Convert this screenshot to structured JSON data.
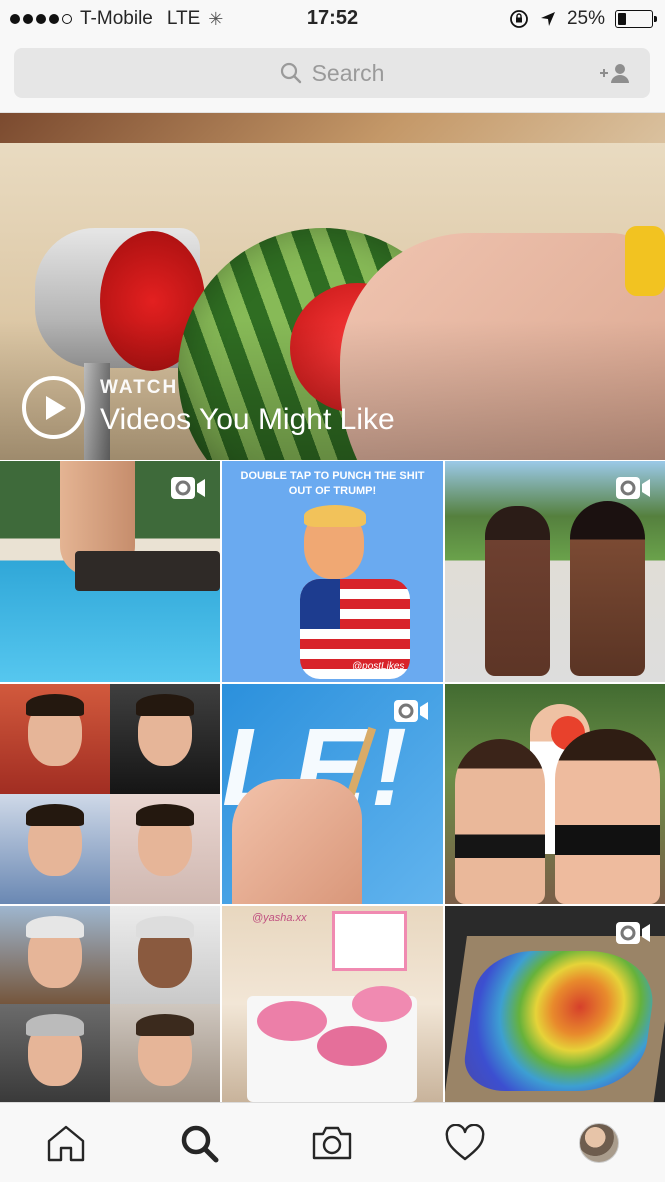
{
  "status_bar": {
    "carrier": "T-Mobile",
    "network": "LTE",
    "time": "17:52",
    "battery_text": "25%",
    "battery_level": 0.25
  },
  "search": {
    "placeholder": "Search",
    "icons": [
      "search-icon",
      "add-person-icon"
    ]
  },
  "featured": {
    "eyebrow": "WATCH",
    "title": "Videos You Might Like",
    "icon": "play-icon"
  },
  "grid": {
    "tile_2_caption": "DOUBLE TAP TO PUNCH THE SHIT OUT OF TRUMP!",
    "tile_2_watermark": "@postLikes",
    "tile_8_watermark": "@yasha.xx",
    "video_tiles": [
      1,
      3,
      5,
      9
    ]
  },
  "tabbar": {
    "icons": [
      "home-icon",
      "search-icon",
      "camera-icon",
      "heart-icon",
      "profile-avatar"
    ],
    "active": "search-icon"
  },
  "colors": {
    "accent": "#262626",
    "muted": "#9a9a9a",
    "search_bg": "#e6e6e6",
    "bar_bg": "#f8f8f8"
  }
}
